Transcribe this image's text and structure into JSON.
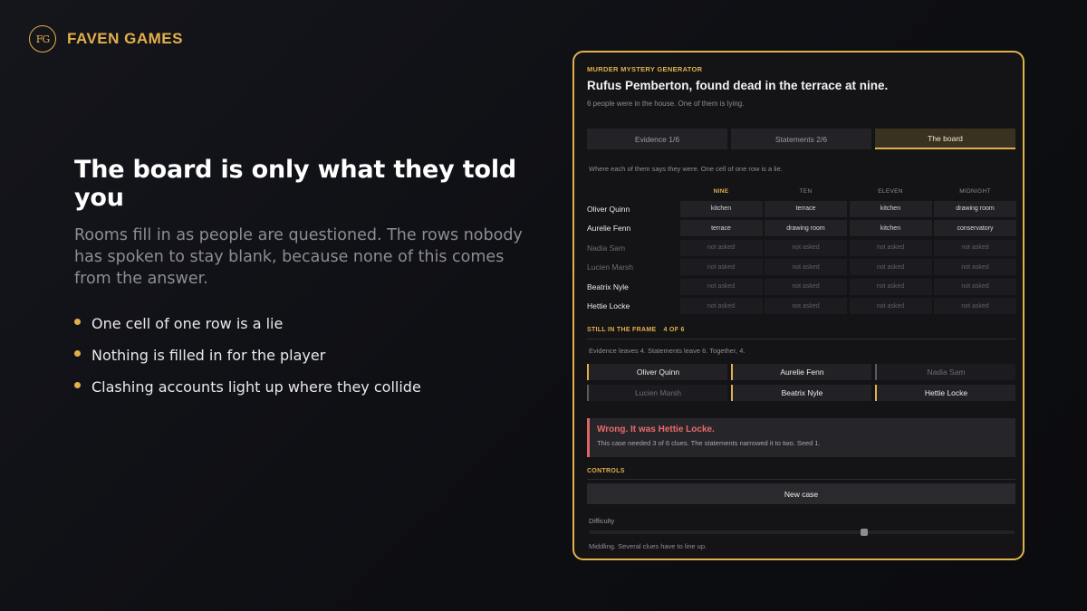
{
  "brand": {
    "logo_text": "FG",
    "name": "FAVEN GAMES"
  },
  "copy": {
    "headline": "The board is only what they told you",
    "subhead": "Rooms fill in as people are questioned. The rows nobody has spoken to stay blank, because none of this comes from the answer.",
    "bullets": [
      "One cell of one row is a lie",
      "Nothing is filled in for the player",
      "Clashing accounts light up where they collide"
    ]
  },
  "panel": {
    "eyebrow": "MURDER MYSTERY GENERATOR",
    "title": "Rufus Pemberton, found dead in the terrace at nine.",
    "lede": "6 people were in the house. One of them is lying.",
    "tabs": [
      {
        "label": "Evidence  1/6",
        "active": false
      },
      {
        "label": "Statements  2/6",
        "active": false
      },
      {
        "label": "The board",
        "active": true
      }
    ],
    "board_note": "Where each of them says they were. One cell of one row is a lie.",
    "columns": [
      "NINE",
      "TEN",
      "ELEVEN",
      "MIDNIGHT"
    ],
    "rows": [
      {
        "name": "Oliver Quinn",
        "cells": [
          "kitchen",
          "terrace",
          "kitchen",
          "drawing room"
        ],
        "asked": true
      },
      {
        "name": "Aurelie Fenn",
        "cells": [
          "terrace",
          "drawing room",
          "kitchen",
          "conservatory"
        ],
        "asked": true
      },
      {
        "name": "Nadia Sam",
        "cells": [
          "not asked",
          "not asked",
          "not asked",
          "not asked"
        ],
        "asked": false
      },
      {
        "name": "Lucien Marsh",
        "cells": [
          "not asked",
          "not asked",
          "not asked",
          "not asked"
        ],
        "asked": false
      },
      {
        "name": "Beatrix Nyle",
        "cells": [
          "not asked",
          "not asked",
          "not asked",
          "not asked"
        ],
        "asked": true
      },
      {
        "name": "Hettie Locke",
        "cells": [
          "not asked",
          "not asked",
          "not asked",
          "not asked"
        ],
        "asked": true
      }
    ],
    "frame": {
      "heading": "STILL IN THE FRAME",
      "count": "4 OF 6",
      "note": "Evidence leaves 4.  Statements leave 6.  Together, 4.",
      "suspects": [
        {
          "name": "Oliver Quinn",
          "in_frame": true
        },
        {
          "name": "Aurelie Fenn",
          "in_frame": true
        },
        {
          "name": "Nadia Sam",
          "in_frame": false
        },
        {
          "name": "Lucien Marsh",
          "in_frame": false
        },
        {
          "name": "Beatrix Nyle",
          "in_frame": true
        },
        {
          "name": "Hettie Locke",
          "in_frame": true
        }
      ]
    },
    "verdict": {
      "title": "Wrong. It was Hettie Locke.",
      "detail": "This case needed 3 of 6 clues. The statements narrowed it to two. Seed 1."
    },
    "controls": {
      "heading": "CONTROLS",
      "new_case": "New case",
      "difficulty_label": "Difficulty",
      "difficulty_value": 0.65,
      "difficulty_note": "Middling. Several clues have to line up."
    }
  },
  "colors": {
    "accent": "#e2b04a",
    "panel_bg": "#141417",
    "error": "#ea6a6a"
  }
}
